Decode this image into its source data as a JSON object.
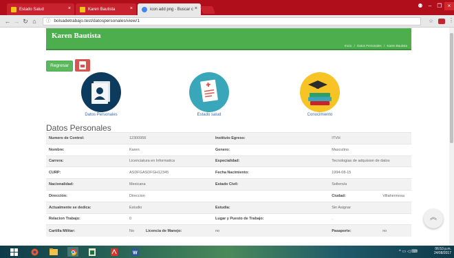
{
  "browser": {
    "tabs": [
      {
        "title": "Estado Salud",
        "active": false
      },
      {
        "title": "Karen Bautista",
        "active": true
      },
      {
        "title": "icon add png - Buscar c",
        "active": false
      }
    ],
    "url": "bolsadetrabajo.test/datospersonales/view/1"
  },
  "header": {
    "title": "Karen Bautista",
    "breadcrumb": [
      "Inicio",
      "Datos Personales",
      "Karen Bautista"
    ]
  },
  "actions": {
    "back_label": "Regresar"
  },
  "nav_icons": [
    {
      "label": "Datos Personales",
      "icon": "id-card-icon"
    },
    {
      "label": "Estado salud",
      "icon": "health-report-icon"
    },
    {
      "label": "Conocimiento",
      "icon": "books-icon"
    }
  ],
  "section_title": "Datos Personales",
  "details": {
    "rows": [
      [
        {
          "l": "Numero de Control:",
          "v": "12300956"
        },
        {
          "l": "Instituto Egreso:",
          "v": "ITVH"
        }
      ],
      [
        {
          "l": "Nombre:",
          "v": "Karen"
        },
        {
          "l": "Genero:",
          "v": "Masculino"
        }
      ],
      [
        {
          "l": "Carrera:",
          "v": "Licenciatura en Informatica"
        },
        {
          "l": "Especialidad:",
          "v": "Tecnologias de adquision de datos"
        }
      ],
      [
        {
          "l": "CURP:",
          "v": "ASDFGASDFGH12345"
        },
        {
          "l": "Fecha Nacimiento:",
          "v": "1994-08-15"
        }
      ],
      [
        {
          "l": "Nacionalidad:",
          "v": "Mexicana"
        },
        {
          "l": "Estado Civil:",
          "v": "Soltero/a"
        }
      ]
    ],
    "direccion": {
      "l": "Dirección:",
      "v": "Direccion",
      "ciudad_l": "Ciudad:",
      "ciudad_v": "Villahermosa"
    },
    "actualmente": {
      "l": "Actualmente se dedica:",
      "v": "Estudio",
      "estudia_l": "Estudia:",
      "estudia_v": "Sin Asignar"
    },
    "relacion": {
      "l": "Relacion Trabajo:",
      "v": "0",
      "lugar_l": "Lugar y Puesto de Trabajo:",
      "lugar_v": "."
    },
    "cartilla": {
      "l": "Cartilla Militar:",
      "v": "No",
      "lic_l": "Licencia de Manejo:",
      "lic_v": "no",
      "pas_l": "Pasaporte:",
      "pas_v": "no"
    }
  },
  "taskbar": {
    "time": "06:53 p.m.",
    "date": "24/08/2017"
  },
  "colors": {
    "brand_green": "#4cae4c",
    "chrome_red": "#b10e1c"
  }
}
